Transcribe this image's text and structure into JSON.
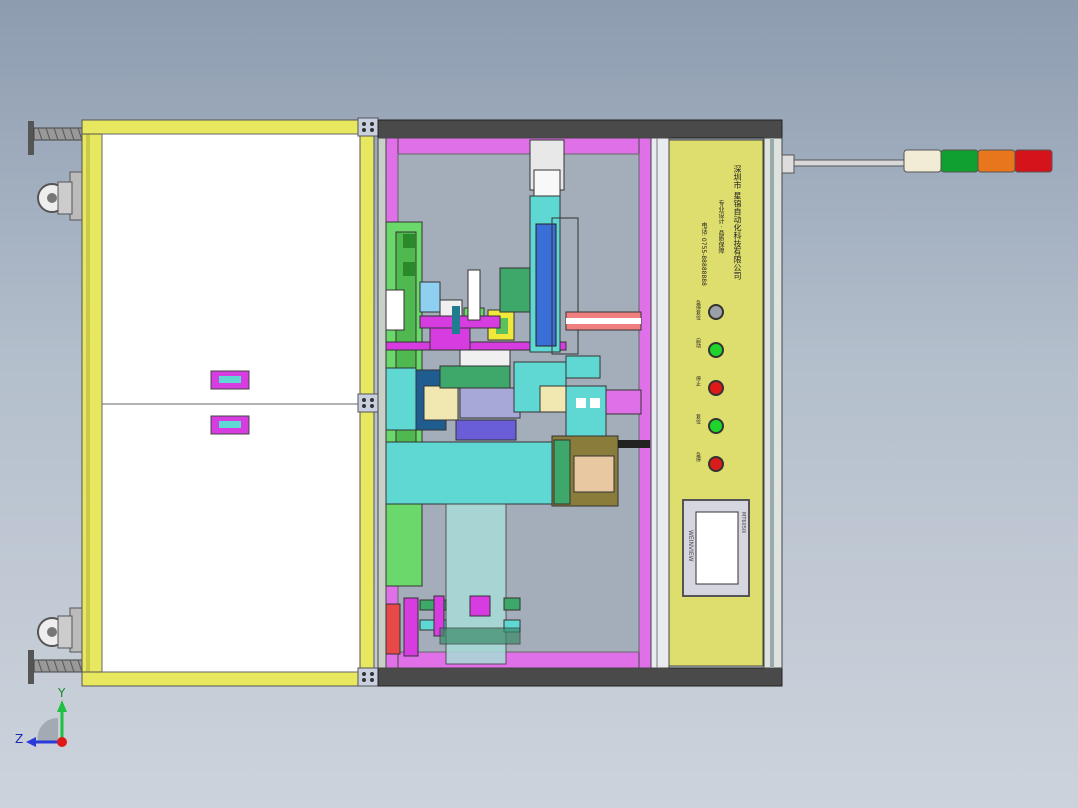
{
  "company_name": "深圳市 星锦自动化科技有限公司",
  "panel_line_2": "专业设计 · 品质保障",
  "panel_line_3": "电话: 0755-88888888",
  "hmi_brand": "WEINVIEW",
  "hmi_model": "MT6050i",
  "buttons": [
    {
      "label": "急停复位",
      "color": "#9aa0a6"
    },
    {
      "label": "启动",
      "color": "#1fd42b"
    },
    {
      "label": "停止",
      "color": "#e01818"
    },
    {
      "label": "复位",
      "color": "#1fd42b"
    },
    {
      "label": "急停",
      "color": "#d81c1c"
    }
  ],
  "signal_tower": [
    "#f2ecd6",
    "#10a030",
    "#e8761c",
    "#d4141a"
  ],
  "axis_labels": {
    "y": "Y",
    "z": "Z"
  },
  "colors": {
    "frame_yellow": "#e8e860",
    "panel_yellow": "#dede6e",
    "magenta": "#d63ce0",
    "cyan": "#5fd8d4",
    "green": "#6ad86a",
    "blue": "#3b6fd8"
  }
}
